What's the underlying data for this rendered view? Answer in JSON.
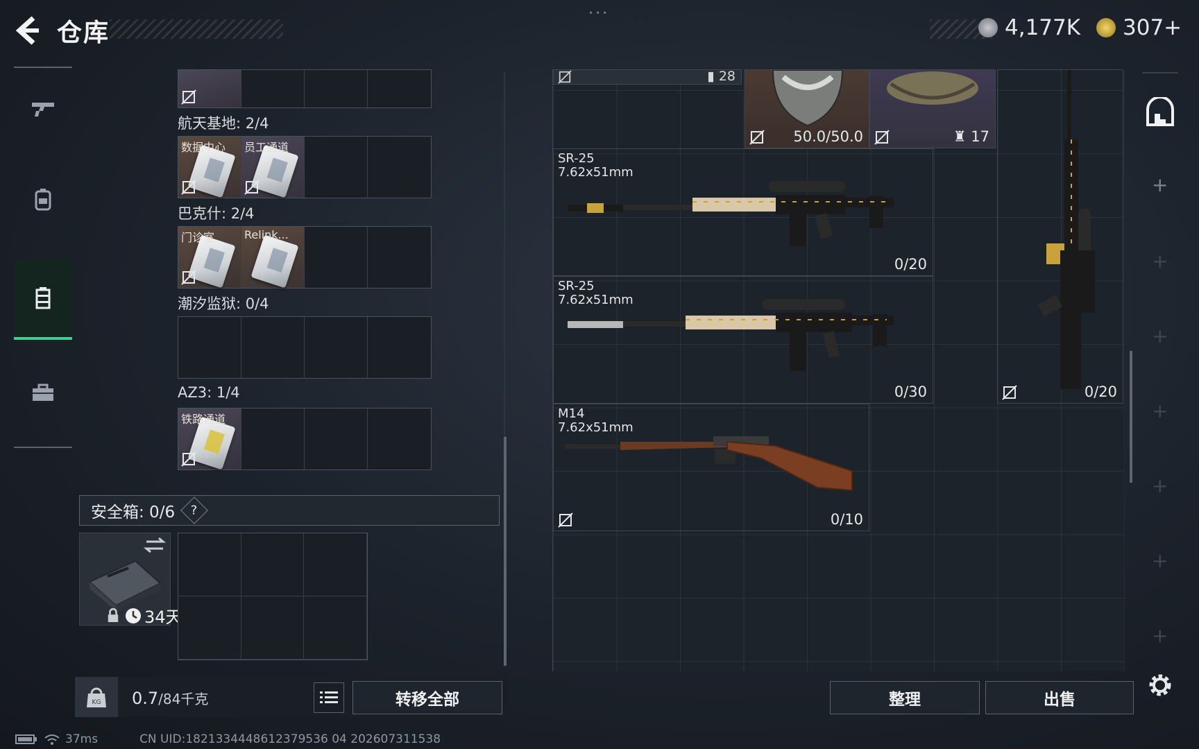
{
  "header": {
    "title": "仓库",
    "currency": [
      {
        "value": "4,177K",
        "icon": "silver-coin-icon",
        "color": "#8d9299"
      },
      {
        "value": "307+",
        "icon": "gold-coin-icon",
        "color": "#c7a43a"
      }
    ]
  },
  "nav": {
    "items": [
      "weapon-icon",
      "backpack-icon",
      "container-icon",
      "briefcase-icon"
    ],
    "active_index": 2,
    "accent": "#3fcf93"
  },
  "keycards": {
    "groups": [
      {
        "label": "航天基地: 2/4",
        "slots": [
          "数据中心",
          "员工通道",
          "",
          ""
        ]
      },
      {
        "label": "巴克什: 2/4",
        "slots": [
          "门诊室",
          "Relink...",
          "",
          ""
        ]
      },
      {
        "label": "潮汐监狱: 0/4",
        "slots": [
          "",
          "",
          "",
          ""
        ]
      },
      {
        "label": "AZ3: 1/4",
        "slots": [
          "铁路通道",
          "",
          "",
          ""
        ]
      }
    ]
  },
  "safebox": {
    "label": "安全箱: 0/6",
    "help": "?",
    "days": "34天"
  },
  "footer": {
    "weight_current": "0.7",
    "weight_max": "/84千克",
    "transfer_all": "转移全部",
    "sort": "整理",
    "sell": "出售"
  },
  "stash": {
    "items": [
      {
        "name": "",
        "count": "28",
        "kind": "top-strip"
      },
      {
        "name": "",
        "count": "50.0/50.0",
        "kind": "helmet"
      },
      {
        "name": "",
        "count": "17",
        "kind": "pouch"
      },
      {
        "name": "SR-25\n7.62x51mm",
        "count": "0/20",
        "kind": "rifle"
      },
      {
        "name": "SR-25\n7.62x51mm",
        "count": "0/30",
        "kind": "rifle"
      },
      {
        "name": "",
        "count": "0/20",
        "kind": "rifle-vertical"
      },
      {
        "name": "M14\n7.62x51mm",
        "count": "0/10",
        "kind": "m14"
      }
    ]
  },
  "status": {
    "ping": "37ms",
    "uid": "CN UID:1821334448612379536 04 202607311538"
  }
}
